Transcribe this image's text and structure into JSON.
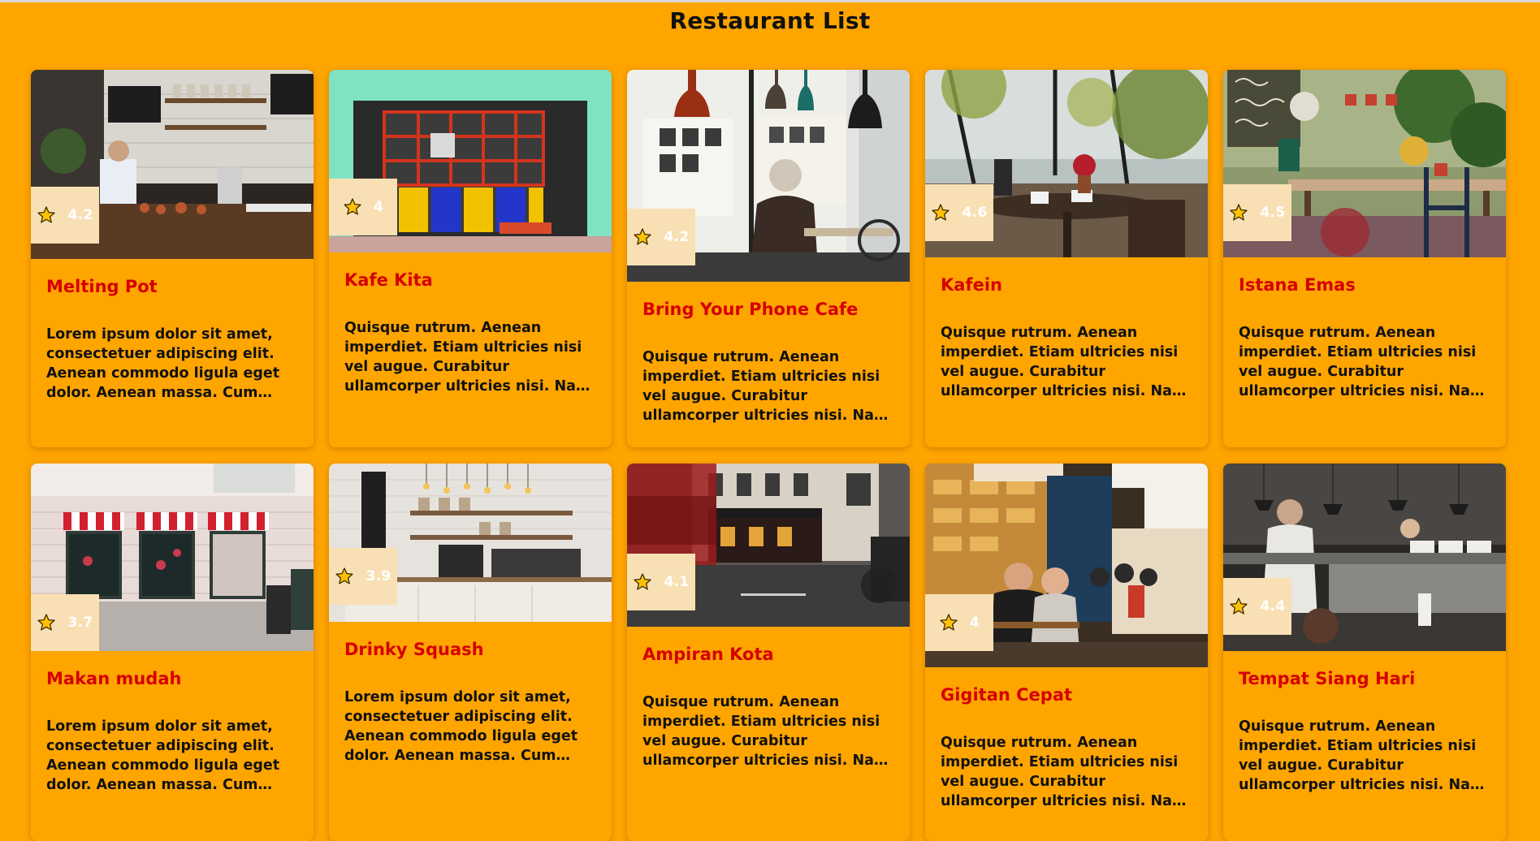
{
  "page": {
    "title": "Restaurant List"
  },
  "colors": {
    "background": "#FFA500",
    "name": "#D50000",
    "badge": "#F8E0B4"
  },
  "restaurants": [
    {
      "name": "Melting Pot",
      "rating": "4.2",
      "description": "Lorem ipsum dolor sit amet, consectetuer adipiscing elit. Aenean commodo ligula eget dolor. Aenean massa. Cum sociis natoque penatibus et magnis dis parturient montes, nascetur ridiculus mus.",
      "image": "cafe-interior-counter-photo"
    },
    {
      "name": "Kafe Kita",
      "rating": "4",
      "description": "Quisque rutrum. Aenean imperdiet. Etiam ultricies nisi vel augue. Curabitur ullamcorper ultricies nisi. Nam eget dui. Etiam rhoncus. Maecenas tempus, tellus eget condimentum rhoncus.",
      "image": "colorful-shopfront-photo"
    },
    {
      "name": "Bring Your Phone Cafe",
      "rating": "4.2",
      "description": "Quisque rutrum. Aenean imperdiet. Etiam ultricies nisi vel augue. Curabitur ullamcorper ultricies nisi. Nam eget dui. Etiam rhoncus. Maecenas tempus, tellus eget condimentum rhoncus.",
      "image": "man-at-cafe-window-photo"
    },
    {
      "name": "Kafein",
      "rating": "4.6",
      "description": "Quisque rutrum. Aenean imperdiet. Etiam ultricies nisi vel augue. Curabitur ullamcorper ultricies nisi. Nam eget dui. Etiam rhoncus. Maecenas tempus, tellus eget condimentum rhoncus.",
      "image": "greenhouse-cafe-table-photo"
    },
    {
      "name": "Istana Emas",
      "rating": "4.5",
      "description": "Quisque rutrum. Aenean imperdiet. Etiam ultricies nisi vel augue. Curabitur ullamcorper ultricies nisi. Nam eget dui. Etiam rhoncus. Maecenas tempus, tellus eget condimentum rhoncus.",
      "image": "garden-terrace-photo"
    },
    {
      "name": "Makan mudah",
      "rating": "3.7",
      "description": "Lorem ipsum dolor sit amet, consectetuer adipiscing elit. Aenean commodo ligula eget dolor. Aenean massa. Cum sociis natoque penatibus et magnis dis parturient montes, nascetur ridiculus mus.",
      "image": "storefront-awnings-photo"
    },
    {
      "name": "Drinky Squash",
      "rating": "3.9",
      "description": "Lorem ipsum dolor sit amet, consectetuer adipiscing elit. Aenean commodo ligula eget dolor. Aenean massa. Cum sociis natoque penatibus et magnis dis parturient montes, nascetur ridiculus mus.",
      "image": "coffee-bar-counter-photo"
    },
    {
      "name": "Ampiran Kota",
      "rating": "4.1",
      "description": "Quisque rutrum. Aenean imperdiet. Etiam ultricies nisi vel augue. Curabitur ullamcorper ultricies nisi. Nam eget dui. Etiam rhoncus. Maecenas tempus, tellus eget condimentum rhoncus.",
      "image": "london-street-photo"
    },
    {
      "name": "Gigitan Cepat",
      "rating": "4",
      "description": "Quisque rutrum. Aenean imperdiet. Etiam ultricies nisi vel augue. Curabitur ullamcorper ultricies nisi. Nam eget dui. Etiam rhoncus. Maecenas tempus, tellus eget condimentum rhoncus.",
      "image": "bakery-street-diners-photo"
    },
    {
      "name": "Tempat Siang Hari",
      "rating": "4.4",
      "description": "Quisque rutrum. Aenean imperdiet. Etiam ultricies nisi vel augue. Curabitur ullamcorper ultricies nisi. Nam eget dui. Etiam rhoncus. Maecenas tempus, tellus eget condimentum rhoncus.",
      "image": "restaurant-kitchen-photo"
    }
  ]
}
